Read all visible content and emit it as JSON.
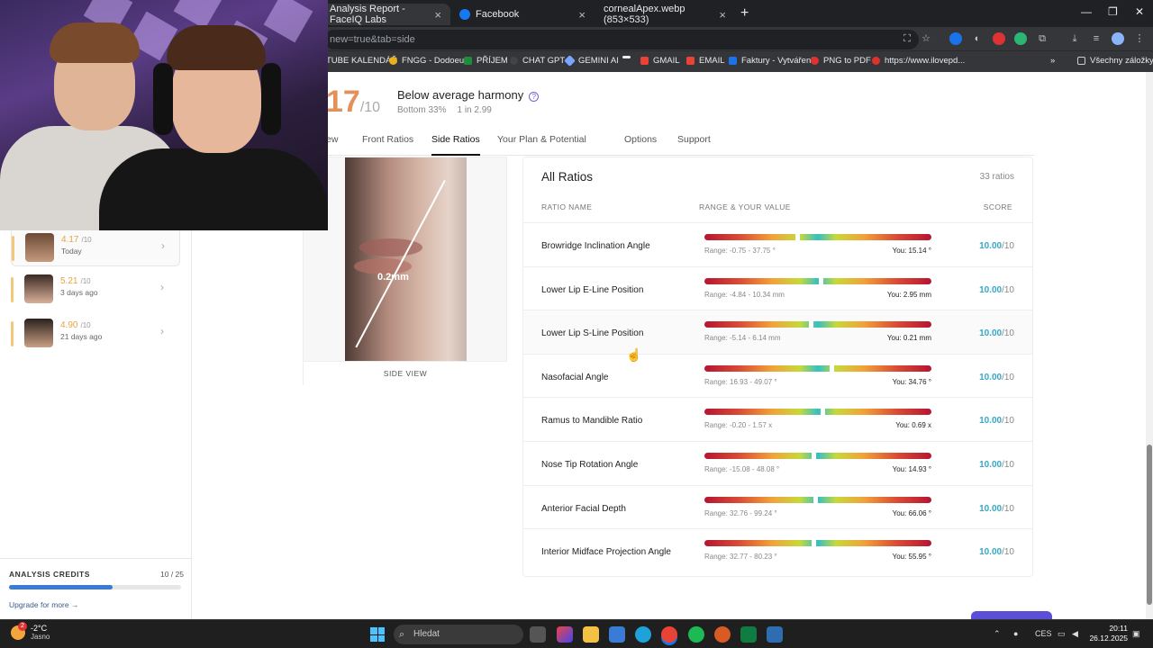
{
  "browser": {
    "tabs": [
      {
        "label": "Analysis Report - FaceIQ Labs",
        "active": true
      },
      {
        "label": "Facebook",
        "active": false
      },
      {
        "label": "cornealApex.webp (853×533)",
        "active": false
      }
    ],
    "url": "new=true&tab=side",
    "bookmarks": [
      {
        "label": "TUBE KALENDÁŘ",
        "color": "#d23b3b"
      },
      {
        "label": "FNGG - Dodoeu",
        "color": "#e9b21c"
      },
      {
        "label": "PŘÍJEM",
        "color": "#1e8e3e"
      },
      {
        "label": "CHAT GPT",
        "color": "#444"
      },
      {
        "label": "GEMINI AI",
        "color": "#7aa6ff"
      },
      {
        "label": "",
        "color": "#111"
      },
      {
        "label": "GMAIL",
        "color": "#e94335"
      },
      {
        "label": "EMAIL",
        "color": "#e94335"
      },
      {
        "label": "Faktury - Vytváření",
        "color": "#1a73e8"
      },
      {
        "label": "PNG to PDF",
        "color": "#e03131"
      },
      {
        "label": "https://www.ilovepd...",
        "color": "#e03131"
      }
    ],
    "all_bookmarks": "Všechny záložky"
  },
  "header": {
    "score": "17",
    "score_max": "/10",
    "harmony": "Below average harmony",
    "percentile": "Bottom 33%",
    "odds": "1 in 2.99"
  },
  "nav_tabs": [
    "ew",
    "Front Ratios",
    "Side Ratios",
    "Your Plan & Potential",
    "Options",
    "Support"
  ],
  "image_panel": {
    "measurement": "0.2mm",
    "caption": "SIDE VIEW"
  },
  "history": [
    {
      "score": "4.17",
      "max": "/10",
      "when": "Today"
    },
    {
      "score": "5.21",
      "max": "/10",
      "when": "3 days ago"
    },
    {
      "score": "4.90",
      "max": "/10",
      "when": "21 days ago"
    }
  ],
  "credits": {
    "label": "ANALYSIS CREDITS",
    "count": "10 / 25",
    "used_fraction": 0.6,
    "upgrade": "Upgrade for more →"
  },
  "ratios": {
    "title": "All Ratios",
    "count": "33 ratios",
    "col_name": "RATIO NAME",
    "col_range": "RANGE & YOUR VALUE",
    "col_score": "SCORE",
    "rows": [
      {
        "name": "Browridge Inclination Angle",
        "range": "Range: -0.75 - 37.75 °",
        "you": "You: 15.14 °",
        "score": "10.00",
        "max": "/10",
        "marker": 0.41
      },
      {
        "name": "Lower Lip E-Line Position",
        "range": "Range: -4.84 - 10.34 mm",
        "you": "You: 2.95 mm",
        "score": "10.00",
        "max": "/10",
        "marker": 0.51
      },
      {
        "name": "Lower Lip S-Line Position",
        "range": "Range: -5.14 - 6.14 mm",
        "you": "You: 0.21 mm",
        "score": "10.00",
        "max": "/10",
        "marker": 0.47
      },
      {
        "name": "Nasofacial Angle",
        "range": "Range: 16.93 - 49.07 °",
        "you": "You: 34.76 °",
        "score": "10.00",
        "max": "/10",
        "marker": 0.56
      },
      {
        "name": "Ramus to Mandible Ratio",
        "range": "Range: -0.20 - 1.57 x",
        "you": "You: 0.69 x",
        "score": "10.00",
        "max": "/10",
        "marker": 0.52
      },
      {
        "name": "Nose Tip Rotation Angle",
        "range": "Range: -15.08 - 48.08 °",
        "you": "You: 14.93 °",
        "score": "10.00",
        "max": "/10",
        "marker": 0.48
      },
      {
        "name": "Anterior Facial Depth",
        "range": "Range: 32.76 - 99.24 °",
        "you": "You: 66.06 °",
        "score": "10.00",
        "max": "/10",
        "marker": 0.49
      },
      {
        "name": "Interior Midface Projection Angle",
        "range": "Range: 32.77 - 80.23 °",
        "you": "You: 55.95 °",
        "score": "10.00",
        "max": "/10",
        "marker": 0.48
      }
    ]
  },
  "taskbar": {
    "temp": "-2°C",
    "weather": "Jasno",
    "badge": "2",
    "search_placeholder": "Hledat",
    "lang": "CES",
    "time": "20:11",
    "date": "26.12.2025"
  }
}
